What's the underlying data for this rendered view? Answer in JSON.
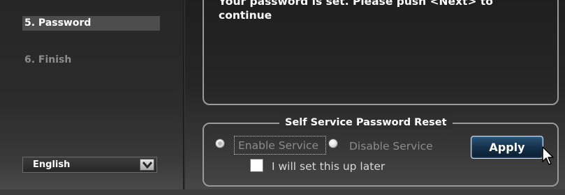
{
  "sidebar": {
    "steps": [
      {
        "label": "5. Password",
        "active": true
      },
      {
        "label": "6. Finish",
        "active": false
      }
    ],
    "language": {
      "selected": "English"
    }
  },
  "main": {
    "message": "Your password is set. Please push <Next> to continue",
    "sspr": {
      "title": "Self Service Password Reset",
      "enable_label": "Enable Service",
      "disable_label": "Disable Service",
      "later_label": "I will set this up later",
      "enable_selected": true
    },
    "apply_label": "Apply"
  },
  "colors": {
    "accent": "#16344f",
    "active_step_bg": "#4d4d4d",
    "inactive_text": "#8c8c8c",
    "border": "#9a9a9a"
  },
  "icons": [
    "chevron-down-icon",
    "radio-selected-icon",
    "radio-unselected-icon",
    "checkbox-icon",
    "mouse-cursor-icon"
  ]
}
